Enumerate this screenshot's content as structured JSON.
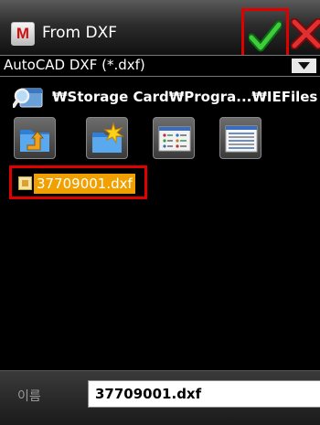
{
  "window": {
    "title": "From DXF",
    "app_icon_letter": "M"
  },
  "filter": {
    "selected": "AutoCAD DXF (*.dxf)"
  },
  "path": {
    "text": "₩Storage Card₩Progra...₩IEFiles"
  },
  "toolbar": {
    "buttons": [
      {
        "icon": "up-folder-icon"
      },
      {
        "icon": "new-folder-icon"
      },
      {
        "icon": "list-view-icon"
      },
      {
        "icon": "details-view-icon"
      }
    ]
  },
  "files": [
    {
      "name": "37709001.dxf",
      "selected": true
    }
  ],
  "name_field": {
    "label": "이름",
    "value": "37709001.dxf"
  },
  "colors": {
    "accent_red": "#e00000",
    "selection": "#f0a000",
    "ok_green": "#1fa52a",
    "close_red": "#d42020"
  }
}
